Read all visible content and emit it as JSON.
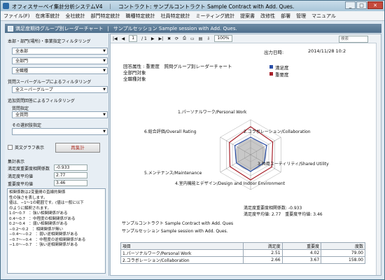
{
  "window": {
    "title": "オフィスサーベイ集計分析システムV4　｜　コントラクト: サンプルコントラクト Sample Contract with Add. Ques."
  },
  "menu": [
    "ファイル(F)",
    "在席率統計",
    "全社統計",
    "部門特定統計",
    "職種特定統計",
    "社員特定統計",
    "ミーティング統計",
    "提案書",
    "改修性",
    "部署",
    "管理",
    "マニュアル"
  ],
  "panel": {
    "title": "満足度期待グループ別レーダーチャート",
    "session": "サンプルセッション Sample session with Add. Ques."
  },
  "left": {
    "filter_label": "本部・部門(場所)・事業指定フィルタリング",
    "dept1": "全本部",
    "dept2": "全部門",
    "dept3": "全職種",
    "group_label": "質問スーパーグループによるフィルタリング",
    "group": "全スーパーグループ",
    "attr_label": "追加質問回答によるフィルタリング",
    "q_label": "質問指定",
    "q_value": "全質問",
    "choice_label": "その選択肢指定",
    "choice_value": "",
    "english_label": "英文グラフ表示",
    "recalc": "再集計",
    "stats_label": "集計表示",
    "stat1_label": "満足度重要度相関係数",
    "stat1_value": "-0.933",
    "stat2_label": "満足度平均値",
    "stat2_value": "2.77",
    "stat3_label": "重要度平均値",
    "stat3_value": "3.46",
    "notes": [
      "相関係数は2変量間の直線的関係",
      "性の強さを表します。",
      "値は、−1～1の範囲です。(値は一般に以下",
      "のように解釈されます。",
      "",
      "1.0～0.7　：強い相関関係がある",
      "0.4～0.7　：中程度の相関関係がある",
      "0.2～0.4　：弱い相関関係がある",
      "−0.2～0.2　：相関関係が無い",
      "−0.4～−0.2　：弱い逆相関関係がある",
      "−0.7～−0.4　：中程度の逆相関関係がある",
      "−1.0～−0.7　：強い逆相関関係がある"
    ]
  },
  "toolbar": {
    "page": "1",
    "total": "/ 1",
    "zoom": "100%",
    "search": "検索"
  },
  "report": {
    "print_label": "出力日時:",
    "print_date": "2014/11/28 10:2",
    "heading": "回答属性 : 重要度　質問グループ別レーダーチャート",
    "sub1": "全部門対象",
    "sub2": "全職種対象",
    "legend1": "満足度",
    "legend2": "重要度",
    "axes": [
      "1.パーソナルワーク/Personal Work",
      "2.コラボレーション/Collaboration",
      "3.共用ユーティリティ/Shared Utility",
      "4.室内機能とデザイン/Design and Indoor Environment",
      "5.メンテナンス/Maintenance",
      "6.総合評価/Overall Rating"
    ],
    "corr": "満足度重要度相関係数: -0.933",
    "avgs": "満足度平均値: 2.77　重要度平均値: 3.46",
    "contract": "サンプルコントラクト Sample Contract with Add. Ques",
    "session": "サンプルセッション Sample session with Add. Ques.",
    "table_head": [
      "項目",
      "満足度",
      "重要度",
      "度数"
    ],
    "rows": [
      [
        "1.パーソナルワーク/Personal Work",
        "2.51",
        "4.02",
        "79.00"
      ],
      [
        "2.コラボレーション/Collaboration",
        "2.66",
        "3.67",
        "158.00"
      ]
    ]
  },
  "colors": {
    "satisfaction": "#2a4fa8",
    "importance": "#a8202a"
  }
}
